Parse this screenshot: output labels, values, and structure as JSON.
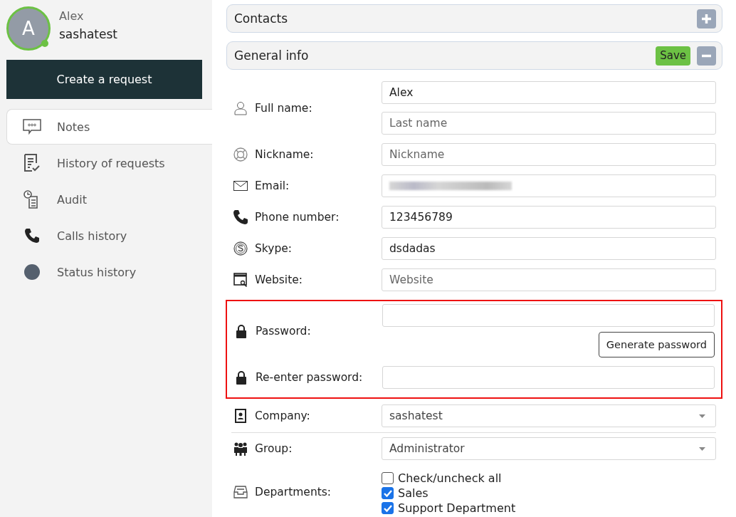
{
  "user": {
    "avatar_letter": "A",
    "online": true,
    "name": "Alex",
    "login": "sashatest"
  },
  "create_button": "Create a request",
  "sidebar": {
    "items": [
      {
        "label": "Notes",
        "selected": true
      },
      {
        "label": "History of requests",
        "selected": false
      },
      {
        "label": "Audit",
        "selected": false
      },
      {
        "label": "Calls history",
        "selected": false
      },
      {
        "label": "Status history",
        "selected": false
      }
    ]
  },
  "panels": [
    {
      "title": "Contacts",
      "expanded": false
    },
    {
      "title": "General info",
      "expanded": true,
      "save": "Save"
    }
  ],
  "form": {
    "rows": [
      {
        "label": "Full name:",
        "fields": [
          {
            "kind": "input",
            "value": "Alex"
          },
          {
            "kind": "input",
            "placeholder": "Last name"
          }
        ]
      },
      {
        "label": "Nickname:",
        "fields": [
          {
            "kind": "input",
            "placeholder": "Nickname"
          }
        ]
      },
      {
        "label": "Email:",
        "fields": [
          {
            "kind": "blurred"
          }
        ]
      },
      {
        "label": "Phone number:",
        "fields": [
          {
            "kind": "input",
            "value": "123456789"
          }
        ]
      },
      {
        "label": "Skype:",
        "fields": [
          {
            "kind": "input",
            "value": "dsdadas"
          }
        ]
      },
      {
        "label": "Website:",
        "fields": [
          {
            "kind": "input",
            "placeholder": "Website"
          }
        ]
      }
    ],
    "password_section": {
      "highlighted": true,
      "rows": [
        {
          "label": "Password:",
          "fields": [
            {
              "kind": "password"
            }
          ],
          "button": "Generate password"
        },
        {
          "label": "Re-enter password:",
          "fields": [
            {
              "kind": "password"
            }
          ]
        }
      ]
    },
    "select_rows": [
      {
        "label": "Company:",
        "fields": [
          {
            "kind": "select",
            "value": "sashatest"
          }
        ]
      },
      {
        "label": "Group:",
        "fields": [
          {
            "kind": "select",
            "value": "Administrator"
          }
        ]
      }
    ],
    "departments": {
      "label": "Departments:",
      "options": [
        {
          "label": "Check/uncheck all",
          "checked": false
        },
        {
          "label": "Sales",
          "checked": true
        },
        {
          "label": "Support Department",
          "checked": true
        }
      ]
    }
  }
}
